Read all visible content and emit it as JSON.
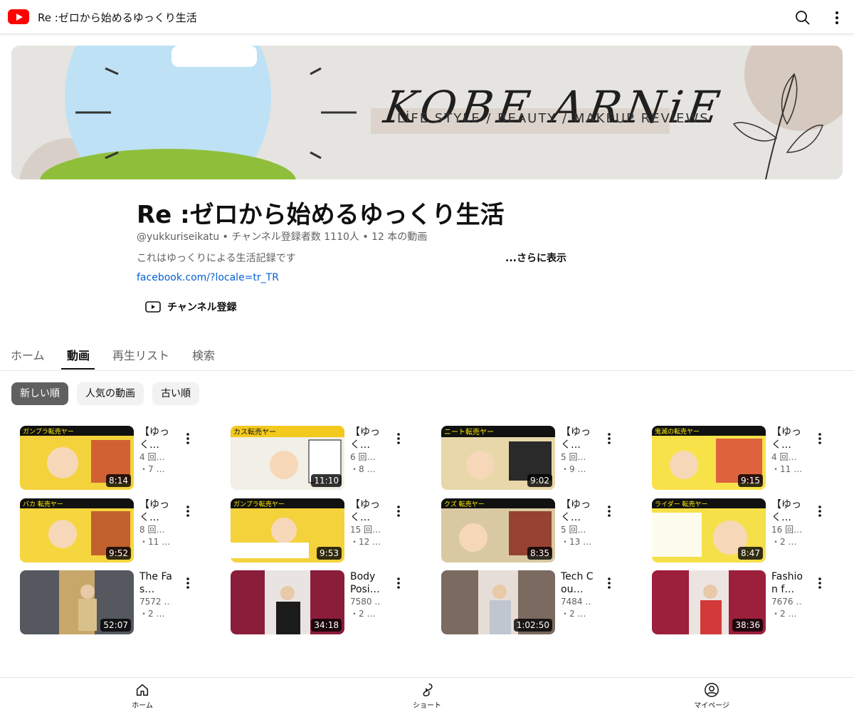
{
  "topbar": {
    "title": "Re :ゼロから始めるゆっくり生活",
    "logo_icon": "youtube-logo-icon",
    "search_icon": "search-icon",
    "more_icon": "more-vertical-icon"
  },
  "banner": {
    "name": "KOBE ARNiE",
    "subtitle": "LİFE STYLE / BEAUTY / MAKEUP REVİEWS"
  },
  "channel": {
    "name": "Re :ゼロから始めるゆっくり生活",
    "meta": "@yukkuriseikatu • チャンネル登録者数 1110人 • 12 本の動画",
    "description": "これはゆっくりによる生活記録です",
    "more_label": "...さらに表示",
    "link": "facebook.com/?locale=tr_TR",
    "subscribe_label": "チャンネル登録"
  },
  "tabs": [
    {
      "label": "ホーム"
    },
    {
      "label": "動画"
    },
    {
      "label": "再生リスト"
    },
    {
      "label": "検索"
    }
  ],
  "chips": [
    {
      "label": "新しい順"
    },
    {
      "label": "人気の動画"
    },
    {
      "label": "古い順"
    }
  ],
  "videos": [
    {
      "title": "【ゆっく…",
      "meta1": "4 回…",
      "meta2": "・7 …",
      "duration": "8:14",
      "bg": "#f4d23c"
    },
    {
      "title": "【ゆっく…",
      "meta1": "6 回…",
      "meta2": "・8 …",
      "duration": "11:10",
      "bg": "#f2efe6"
    },
    {
      "title": "【ゆっく…",
      "meta1": "5 回…",
      "meta2": "・9 …",
      "duration": "9:02",
      "bg": "#e8d7a8"
    },
    {
      "title": "【ゆっく…",
      "meta1": "4 回…",
      "meta2": "・11 …",
      "duration": "9:15",
      "bg": "#f7e24a"
    },
    {
      "title": "【ゆっく…",
      "meta1": "8 回…",
      "meta2": "・11 …",
      "duration": "9:52",
      "bg": "#f6d63e"
    },
    {
      "title": "【ゆっく…",
      "meta1": "15 回…",
      "meta2": "・12 …",
      "duration": "9:53",
      "bg": "#f4d23c"
    },
    {
      "title": "【ゆっく…",
      "meta1": "5 回…",
      "meta2": "・13 …",
      "duration": "8:35",
      "bg": "#d9c9a2"
    },
    {
      "title": "【ゆっく…",
      "meta1": "16 回…",
      "meta2": "・2 …",
      "duration": "8:47",
      "bg": "#f6e04a"
    },
    {
      "title": "The Fas…",
      "meta1": "7572 …",
      "meta2": "・2 …",
      "duration": "52:07",
      "bg": "#55585f"
    },
    {
      "title": "Body Posi…",
      "meta1": "7580 …",
      "meta2": "・2 …",
      "duration": "34:18",
      "bg": "#8a1d3a"
    },
    {
      "title": "Tech Cou…",
      "meta1": "7484 …",
      "meta2": "・2 …",
      "duration": "1:02:50",
      "bg": "#7a6a60"
    },
    {
      "title": "Fashion f…",
      "meta1": "7676 …",
      "meta2": "・2 …",
      "duration": "38:36",
      "bg": "#9c1f3c"
    }
  ],
  "bottom_nav": [
    {
      "label": "ホーム",
      "icon": "home-icon"
    },
    {
      "label": "ショート",
      "icon": "shorts-icon"
    },
    {
      "label": "マイページ",
      "icon": "account-icon"
    }
  ]
}
